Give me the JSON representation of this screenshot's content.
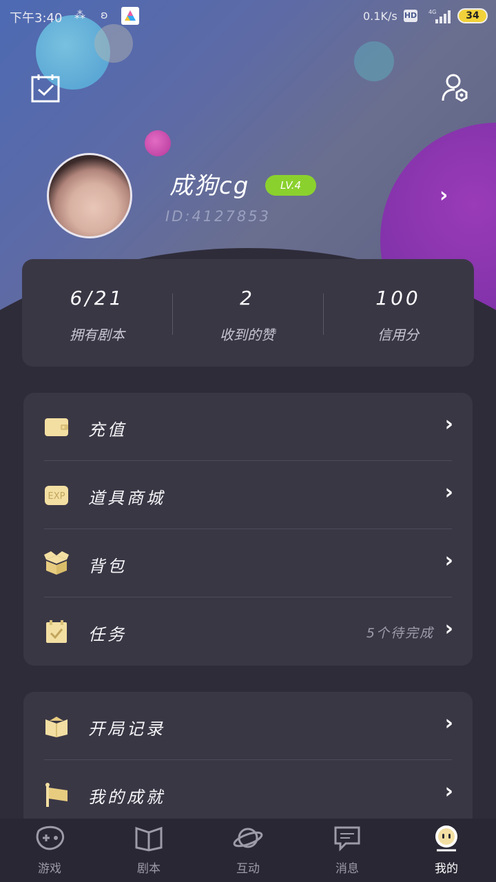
{
  "status_bar": {
    "time": "下午3:40",
    "network_speed": "0.1K/s",
    "hd_badge": "HD",
    "battery": "34"
  },
  "profile": {
    "username": "成狗cg",
    "level": "LV.4",
    "user_id": "ID:4127853"
  },
  "stats": [
    {
      "value": "6/21",
      "label": "拥有剧本"
    },
    {
      "value": "2",
      "label": "收到的赞"
    },
    {
      "value": "100",
      "label": "信用分"
    }
  ],
  "menu_group1": [
    {
      "label": "充值",
      "icon": "wallet-icon"
    },
    {
      "label": "道具商城",
      "icon": "exp-shop-icon"
    },
    {
      "label": "背包",
      "icon": "box-icon"
    },
    {
      "label": "任务",
      "icon": "task-icon",
      "note": "5个待完成"
    }
  ],
  "menu_group2": [
    {
      "label": "开局记录",
      "icon": "book-icon"
    },
    {
      "label": "我的成就",
      "icon": "flag-icon"
    }
  ],
  "tabbar": [
    {
      "label": "游戏",
      "icon": "game-icon"
    },
    {
      "label": "剧本",
      "icon": "book-open-icon"
    },
    {
      "label": "互动",
      "icon": "planet-icon"
    },
    {
      "label": "消息",
      "icon": "chat-bubble-icon"
    },
    {
      "label": "我的",
      "icon": "me-face-icon",
      "active": true
    }
  ],
  "colors": {
    "background": "#2f2c3a",
    "card": "#3a3745",
    "level_badge": "#8bd12e",
    "icon_cream": "#f3dfa2"
  }
}
